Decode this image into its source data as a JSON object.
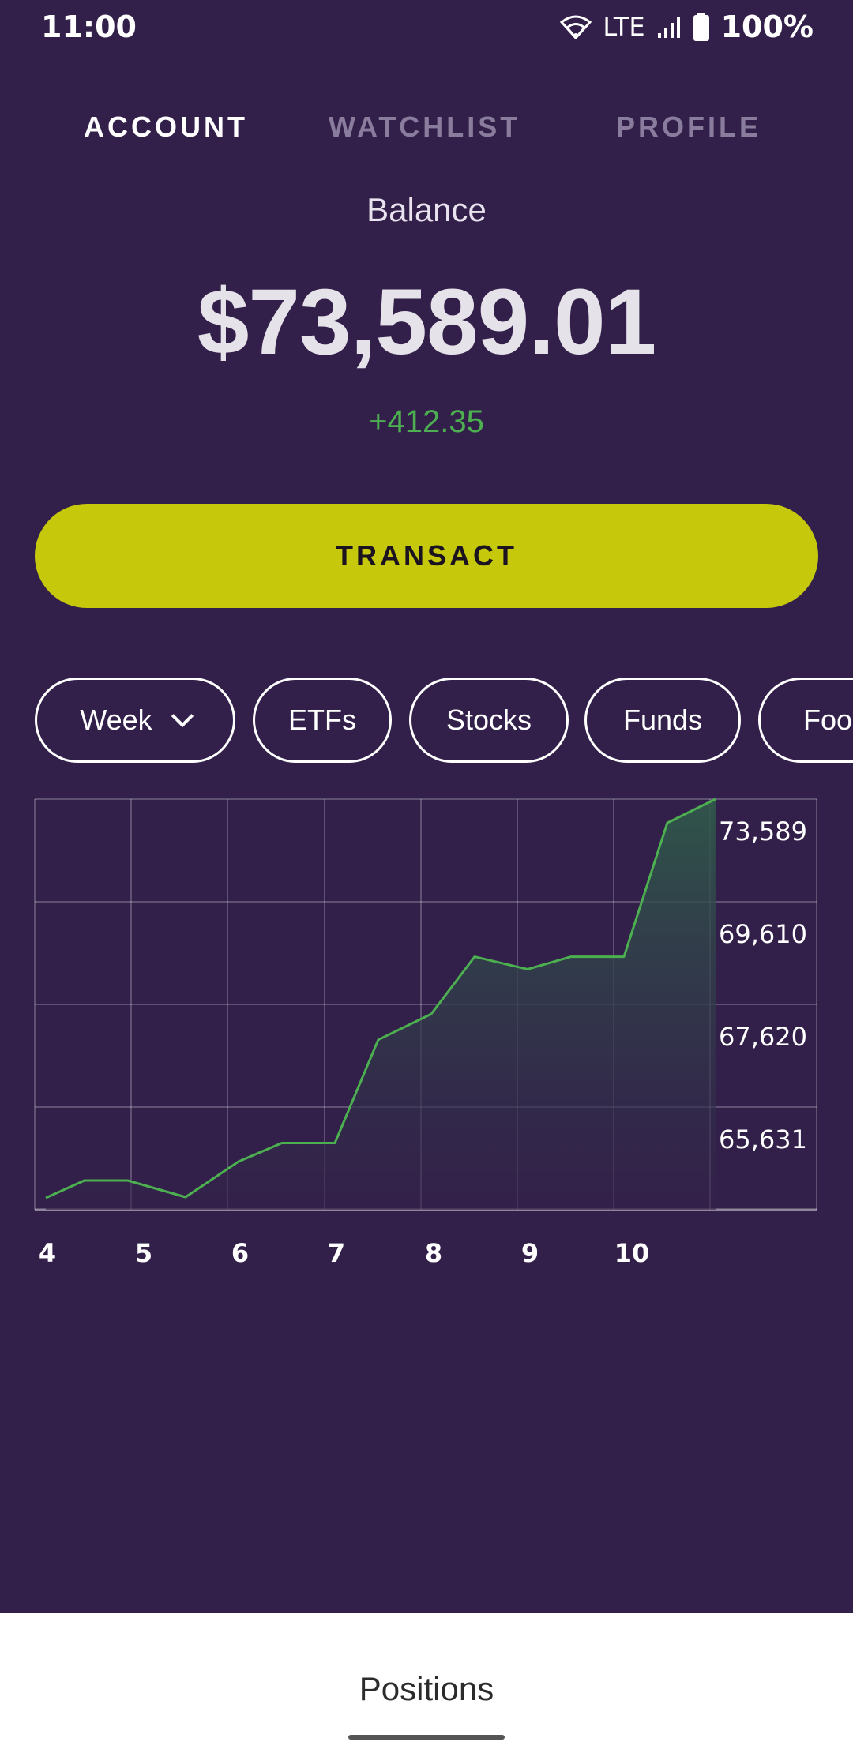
{
  "status_bar": {
    "time": "11:00",
    "network": "LTE",
    "battery": "100%",
    "icons": [
      "wifi-icon",
      "signal-icon",
      "battery-icon"
    ]
  },
  "tabs": [
    {
      "label": "ACCOUNT",
      "active": true
    },
    {
      "label": "WATCHLIST",
      "active": false
    },
    {
      "label": "PROFILE",
      "active": false
    }
  ],
  "balance": {
    "label": "Balance",
    "amount": "$73,589.01",
    "change": "+412.35"
  },
  "transact_button": {
    "label": "TRANSACT"
  },
  "filters": {
    "period": {
      "label": "Week",
      "icon": "chevron-down-icon"
    },
    "chips": [
      "ETFs",
      "Stocks",
      "Funds",
      "Foo"
    ]
  },
  "colors": {
    "background": "#33204a",
    "accent": "#c6c80c",
    "positive": "#4caf50",
    "sheet": "#ffffff"
  },
  "chart_data": {
    "type": "area",
    "x": [
      4,
      4.25,
      4.5,
      4.7,
      5,
      5.25,
      5.5,
      5.75,
      6,
      6.25,
      6.5,
      6.75,
      7,
      7.25,
      7.5,
      7.75,
      8,
      8.25,
      8.5,
      8.75,
      9,
      9.25,
      9.5,
      9.75,
      10,
      10.25,
      10.5,
      10.75
    ],
    "x_ticks": [
      "4",
      "5",
      "6",
      "7",
      "8",
      "9",
      "10"
    ],
    "y_ticks": [
      "73,589",
      "69,610",
      "67,620",
      "65,631"
    ],
    "values": [
      63700,
      64130,
      64130,
      63720,
      64600,
      65060,
      65060,
      67620,
      68260,
      69680,
      69370,
      69680,
      69680,
      73000,
      73589
    ],
    "value_x": [
      4.0,
      4.4,
      4.85,
      5.45,
      6.0,
      6.45,
      7.0,
      7.45,
      8.0,
      8.45,
      9.0,
      9.45,
      10.0,
      10.45,
      10.95
    ],
    "ylim": [
      63641,
      73589
    ],
    "line_color": "#4caf50",
    "grid": true
  },
  "bottom_sheet": {
    "title": "Positions"
  }
}
